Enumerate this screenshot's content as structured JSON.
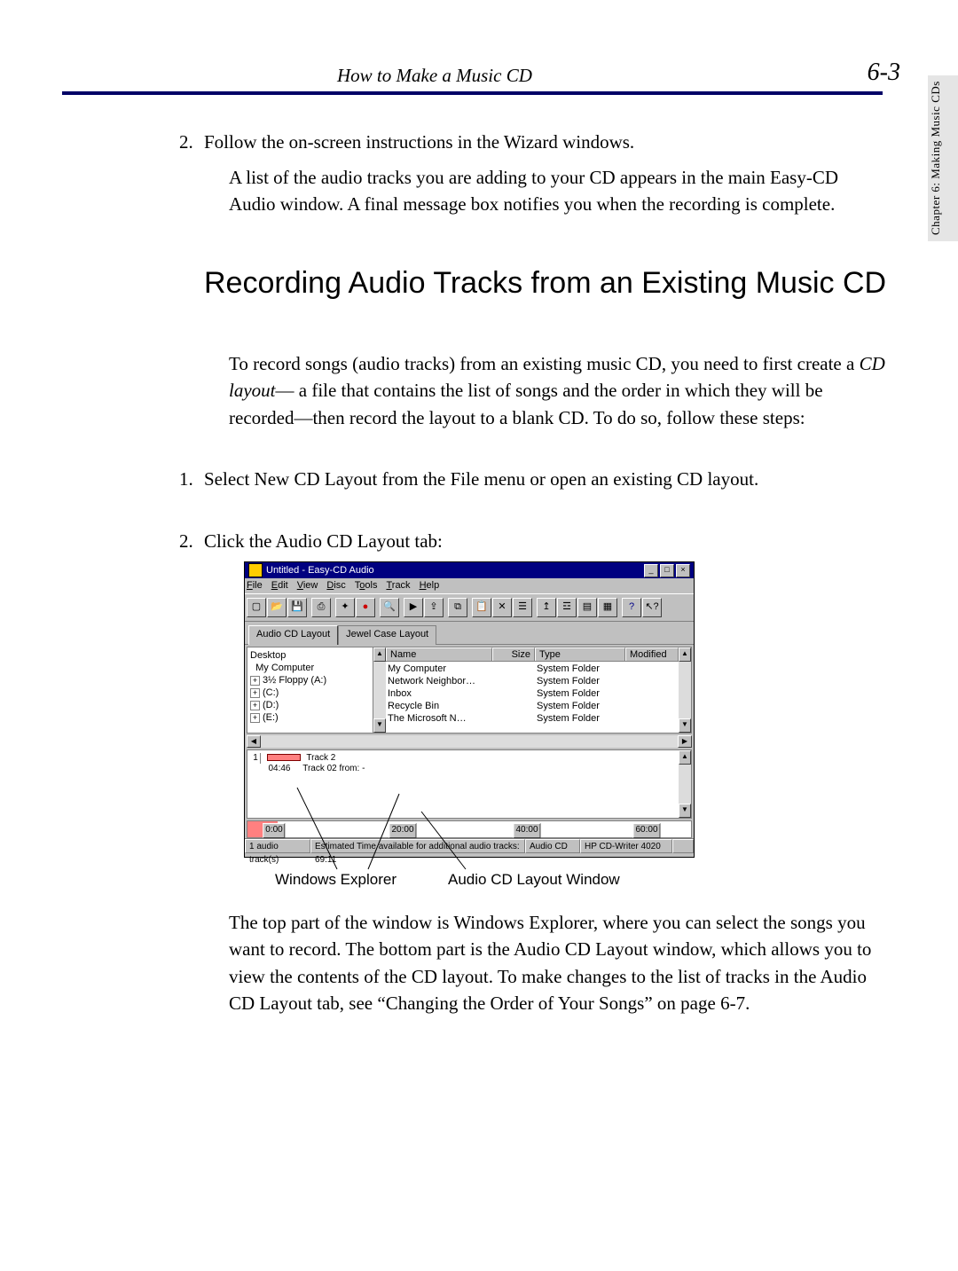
{
  "page": {
    "running_head": "How to Make a Music CD",
    "page_number": "6-3",
    "side_tab": "Chapter 6:  Making Music CDs"
  },
  "body": {
    "step2a": "2.",
    "step2a_text": "Follow the on-screen instructions in the Wizard windows.",
    "step2a_para": "A list of the audio tracks you are adding to your CD appears in the main Easy-CD Audio window. A final message box notifies you when the recording is complete.",
    "h2": "Recording Audio Tracks from an Existing Music CD",
    "intro_a": "To record songs (audio tracks) from an existing music CD, you need to first create a ",
    "intro_em": "CD layout",
    "intro_b": "— a file that contains the list of songs and the order in which they will be recorded—then record the layout to a blank CD. To do so, follow these steps:",
    "step1": "1.",
    "step1_text": "Select New CD Layout from the File menu or open an existing CD layout.",
    "step2b": "2.",
    "step2b_text": "Click the Audio CD Layout tab:",
    "after": "The top part of the window is Windows Explorer, where you can select the songs you want to record. The bottom part is the Audio CD Layout window, which allows you to view the contents of the CD layout. To make changes to the list of tracks in the Audio CD Layout tab, see “Changing the Order of Your Songs” on page 6-7."
  },
  "callouts": {
    "left": "Windows Explorer",
    "right": "Audio CD Layout Window"
  },
  "shot": {
    "title": "Untitled - Easy-CD Audio",
    "menus": {
      "file": "File",
      "edit": "Edit",
      "view": "View",
      "disc": "Disc",
      "tools": "Tools",
      "track": "Track",
      "help": "Help"
    },
    "tabs": {
      "audio": "Audio CD Layout",
      "jewel": "Jewel Case Layout"
    },
    "tree": {
      "root": "Desktop",
      "items": [
        "My Computer",
        "3½ Floppy (A:)",
        "(C:)",
        "(D:)",
        "(E:)"
      ]
    },
    "list": {
      "cols": {
        "name": "Name",
        "size": "Size",
        "type": "Type",
        "mod": "Modified"
      },
      "rows": [
        {
          "name": "My Computer",
          "type": "System Folder"
        },
        {
          "name": "Network Neighbor…",
          "type": "System Folder"
        },
        {
          "name": "Inbox",
          "type": "System Folder"
        },
        {
          "name": "Recycle Bin",
          "type": "System Folder"
        },
        {
          "name": "The Microsoft N…",
          "type": "System Folder"
        }
      ]
    },
    "layout": {
      "num": "1",
      "time": "04:46",
      "trk": "Track 2",
      "from": "Track 02 from:  -"
    },
    "ruler": {
      "t0": "0:00",
      "t1": "20:00",
      "t2": "40:00",
      "t3": "60:00"
    },
    "status": {
      "s1": "1 audio track(s)",
      "s2": "Estimated Time available for additional audio tracks: 69:11",
      "s3": "Audio CD",
      "s4": "HP CD-Writer 4020"
    }
  }
}
